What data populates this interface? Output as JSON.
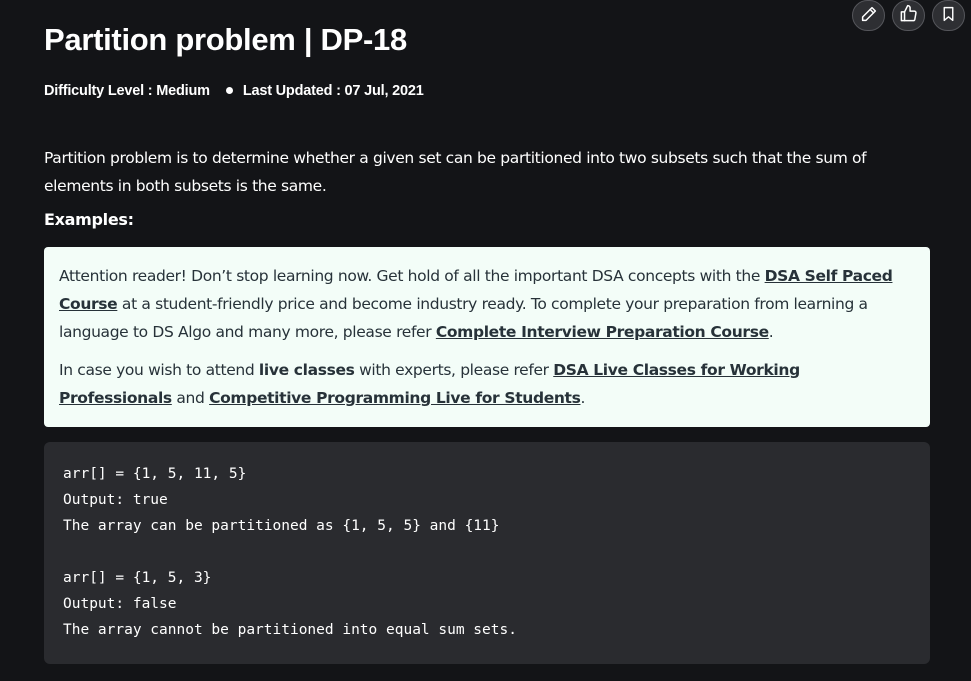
{
  "article": {
    "title": "Partition problem | DP-18",
    "difficulty": "Difficulty Level : Medium",
    "last_updated": "Last Updated : 07 Jul, 2021",
    "intro": "Partition problem is to determine whether a given set can be partitioned into two subsets such that the sum of elements in both subsets is the same.",
    "examples_label": "Examples:"
  },
  "actions": {
    "icons": [
      "pencil-icon",
      "thumbs-up-icon",
      "bookmark-icon"
    ]
  },
  "attention": {
    "p1_text1": "Attention reader! Don’t stop learning now. Get hold of all the important DSA concepts with the ",
    "p1_link1": "DSA Self Paced Course",
    "p1_text2": " at a student-friendly price and become industry ready.  To complete your preparation from learning a language to DS Algo and many more,  please refer ",
    "p1_link2": "Complete Interview Preparation Course",
    "p1_text3": ".",
    "p2_text1": "In case you wish to attend ",
    "p2_bold": "live classes",
    "p2_text2": " with experts, please refer ",
    "p2_link1": "DSA Live Classes for Working Professionals",
    "p2_text3": " and ",
    "p2_link2": "Competitive Programming Live for Students",
    "p2_text4": "."
  },
  "code": {
    "lines": [
      "arr[] = {1, 5, 11, 5}",
      "Output: true ",
      "The array can be partitioned as {1, 5, 5} and {11}",
      "",
      "arr[] = {1, 5, 3}",
      "Output: false ",
      "The array cannot be partitioned into equal sum sets."
    ]
  },
  "colors": {
    "page_bg": "#131417",
    "attention_bg": "#f3fdf8",
    "attention_text": "#273239",
    "code_bg": "#2a2b2f",
    "button_bg": "#2e2f33"
  }
}
